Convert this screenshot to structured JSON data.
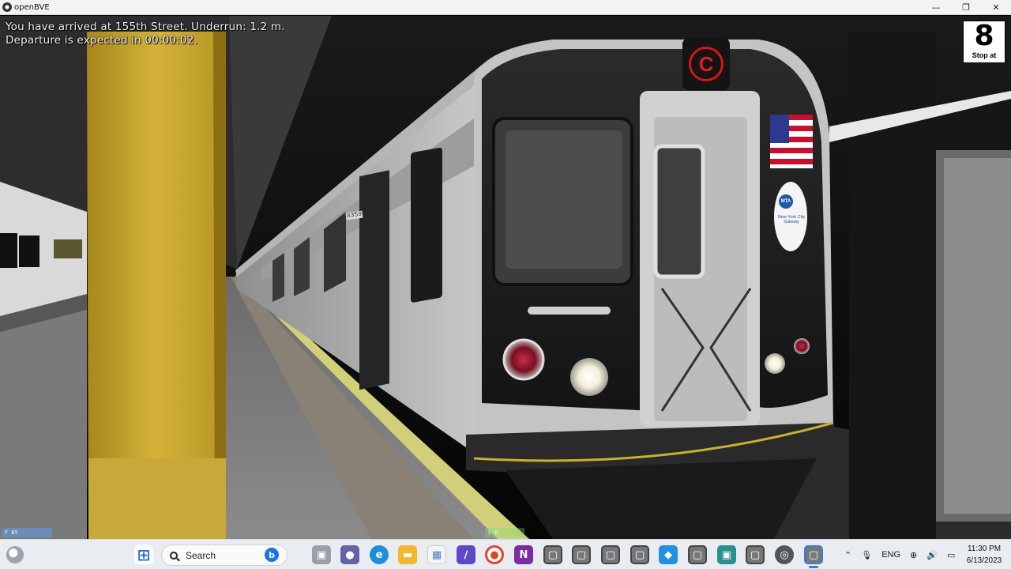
{
  "window": {
    "title": "openBVE",
    "minimize_glyph": "—",
    "maximize_glyph": "❐",
    "close_glyph": "✕"
  },
  "hud": {
    "message_line1": "You have arrived at 155th Street. Underrun: 1.2 m.",
    "message_line2": "Departure is expected in 00:00:02.",
    "stop_sign": {
      "number": "8",
      "label": "Stop at"
    },
    "route_letter": "C",
    "mta_logo_text": "MTA",
    "mta_subtitle": "New York City Subway",
    "car_number": "8359",
    "mini_left_text": "F    B5",
    "mini_right_text": "L  R"
  },
  "taskbar": {
    "search_label": "Search",
    "language": "ENG",
    "time": "11:30 PM",
    "date": "6/13/2023",
    "apps": [
      {
        "name": "start",
        "glyph": "⊞",
        "color": "#2b6fd6"
      },
      {
        "name": "task-view",
        "glyph": "▣",
        "color": "#555"
      },
      {
        "name": "teams-chat",
        "glyph": "●",
        "color": "#6264a7"
      },
      {
        "name": "edge",
        "glyph": "◐",
        "color": "#1c8fd8"
      },
      {
        "name": "file-explorer",
        "glyph": "▬",
        "color": "#f2b633"
      },
      {
        "name": "store",
        "glyph": "▦",
        "color": "#4a7bd0"
      },
      {
        "name": "visual-studio",
        "glyph": "∕",
        "color": "#5f47c8"
      },
      {
        "name": "chrome",
        "glyph": "◉",
        "color": "#e0452b"
      },
      {
        "name": "onenote",
        "glyph": "N",
        "color": "#7b2c9e"
      },
      {
        "name": "openbve-1",
        "glyph": "▢",
        "color": "#666"
      },
      {
        "name": "openbve-2",
        "glyph": "▢",
        "color": "#666"
      },
      {
        "name": "openbve-3",
        "glyph": "▢",
        "color": "#666"
      },
      {
        "name": "openbve-4",
        "glyph": "▢",
        "color": "#666"
      },
      {
        "name": "app-blue",
        "glyph": "◆",
        "color": "#2190e0"
      },
      {
        "name": "openbve-5",
        "glyph": "▢",
        "color": "#666"
      },
      {
        "name": "app-teal",
        "glyph": "▣",
        "color": "#2a8f8f"
      },
      {
        "name": "openbve-6",
        "glyph": "▢",
        "color": "#666"
      },
      {
        "name": "app-red-dot",
        "glyph": "◎",
        "color": "#555"
      },
      {
        "name": "openbve-active",
        "glyph": "▢",
        "color": "#666"
      }
    ]
  }
}
